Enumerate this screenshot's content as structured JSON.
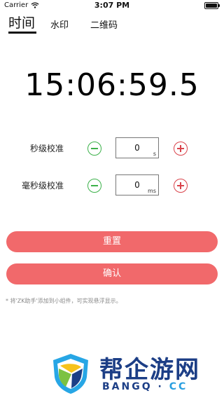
{
  "status_bar": {
    "carrier": "Carrier",
    "time": "3:07 PM"
  },
  "tabs": [
    {
      "label": "时间",
      "active": true
    },
    {
      "label": "水印",
      "active": false
    },
    {
      "label": "二维码",
      "active": false
    }
  ],
  "clock": {
    "value": "15:06:59.5"
  },
  "second_row": {
    "label": "秒级校准",
    "value": "0",
    "unit": "s"
  },
  "ms_row": {
    "label": "毫秒级校准",
    "value": "0",
    "unit": "ms"
  },
  "buttons": {
    "reset": "重置",
    "confirm": "确认"
  },
  "hint": "* 将'ZK助手'添加到小组件，可实现悬浮显示。",
  "brand": {
    "title": "帮企游网",
    "sub_left": "BANGQ",
    "sub_right": "CC",
    "sub_dot": "·"
  },
  "colors": {
    "accent": "#f1696b",
    "minus": "#3cb14a",
    "plus": "#d9434b",
    "brand": "#1c3e86"
  }
}
